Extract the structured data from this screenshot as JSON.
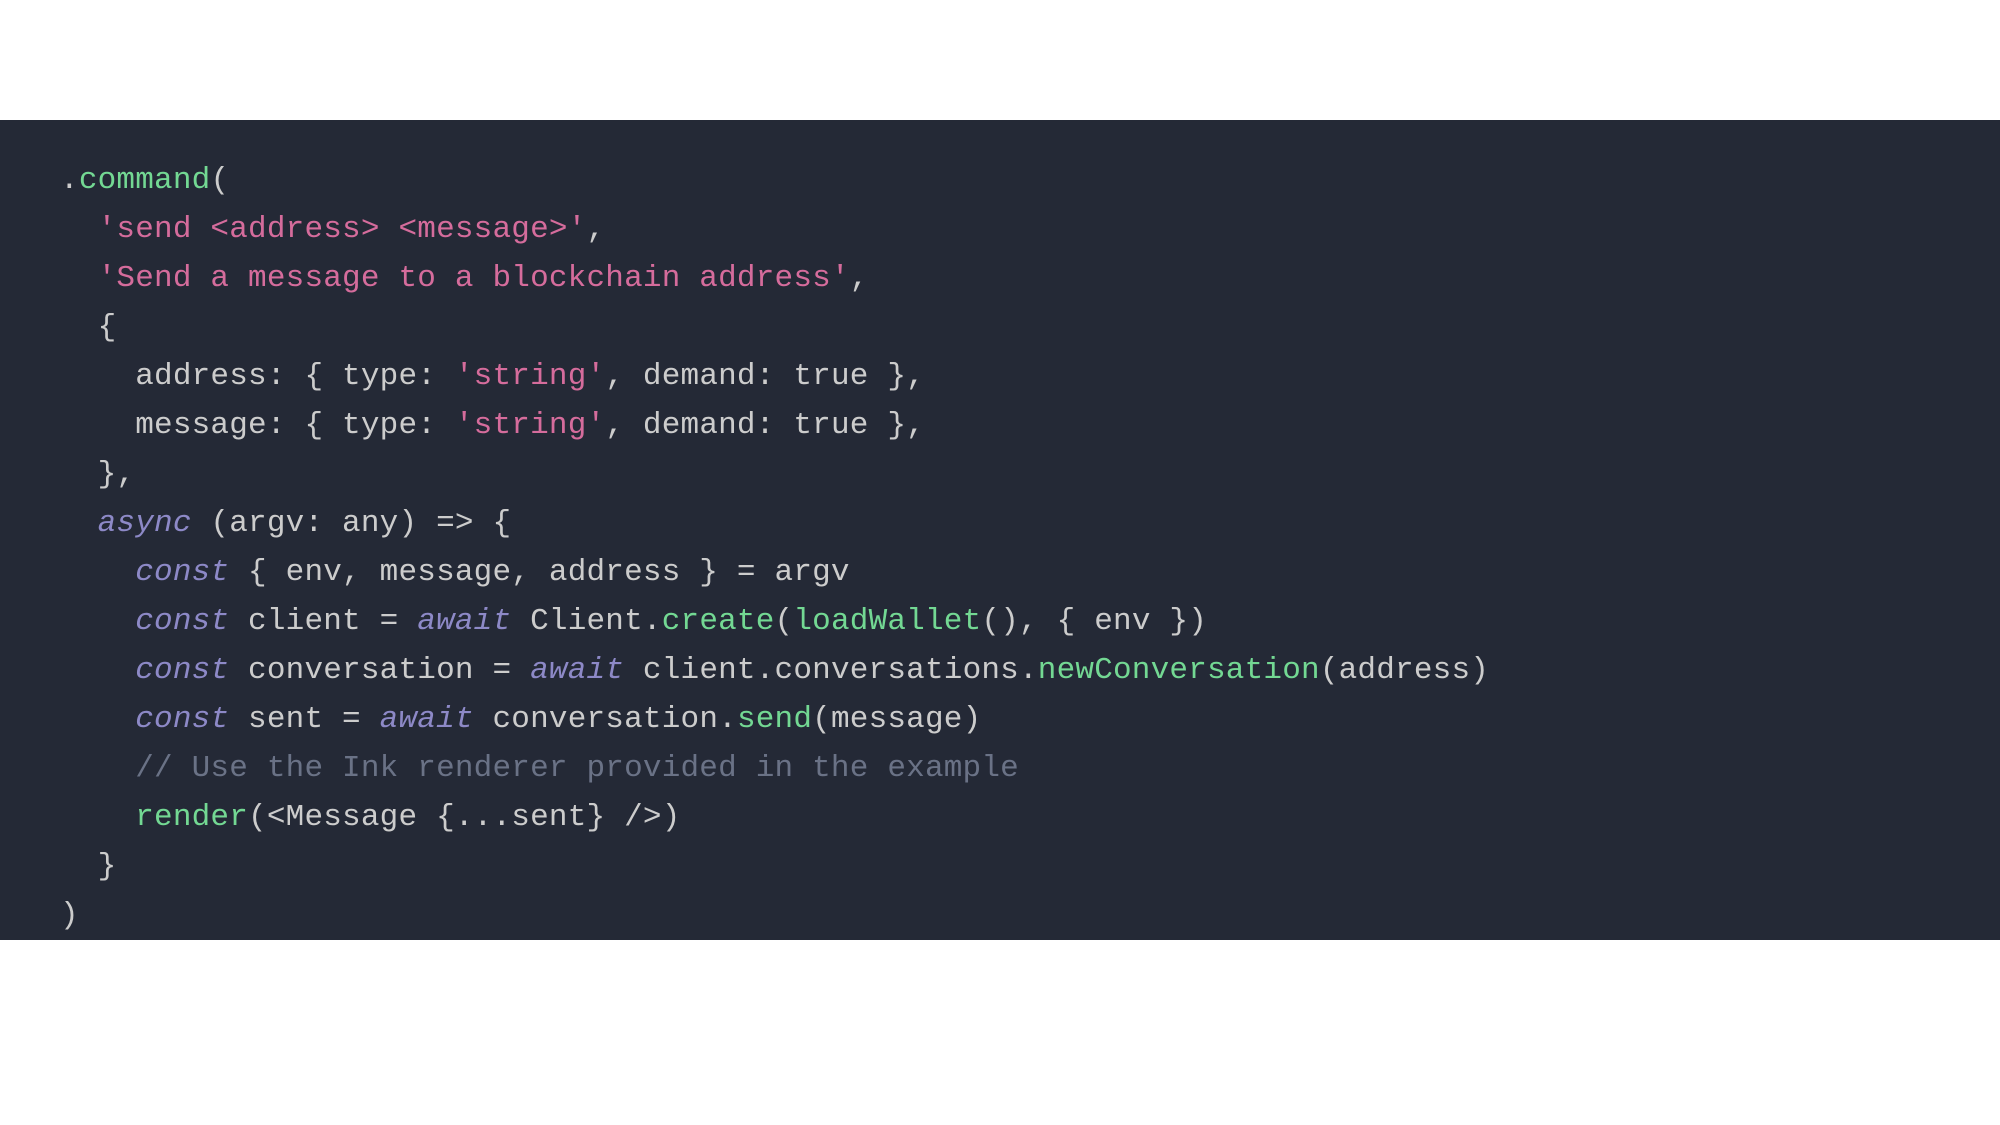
{
  "colors": {
    "background": "#242936",
    "default": "#cccccc",
    "method": "#73d893",
    "string": "#d56c9c",
    "keyword": "#8d89c7",
    "comment": "#6a7286"
  },
  "code": {
    "lines": [
      [
        {
          "cls": "tok-punct",
          "text": "."
        },
        {
          "cls": "tok-method",
          "text": "command"
        },
        {
          "cls": "tok-punct",
          "text": "("
        }
      ],
      [
        {
          "cls": "tok-punct",
          "text": "  "
        },
        {
          "cls": "tok-string",
          "text": "'send <address> <message>'"
        },
        {
          "cls": "tok-punct",
          "text": ","
        }
      ],
      [
        {
          "cls": "tok-punct",
          "text": "  "
        },
        {
          "cls": "tok-string",
          "text": "'Send a message to a blockchain address'"
        },
        {
          "cls": "tok-punct",
          "text": ","
        }
      ],
      [
        {
          "cls": "tok-punct",
          "text": "  {"
        }
      ],
      [
        {
          "cls": "tok-default",
          "text": "    address: { type: "
        },
        {
          "cls": "tok-string",
          "text": "'string'"
        },
        {
          "cls": "tok-default",
          "text": ", demand: true },"
        }
      ],
      [
        {
          "cls": "tok-default",
          "text": "    message: { type: "
        },
        {
          "cls": "tok-string",
          "text": "'string'"
        },
        {
          "cls": "tok-default",
          "text": ", demand: true },"
        }
      ],
      [
        {
          "cls": "tok-punct",
          "text": "  },"
        }
      ],
      [
        {
          "cls": "tok-punct",
          "text": "  "
        },
        {
          "cls": "tok-keyword",
          "text": "async"
        },
        {
          "cls": "tok-default",
          "text": " (argv: any) => {"
        }
      ],
      [
        {
          "cls": "tok-punct",
          "text": "    "
        },
        {
          "cls": "tok-keyword",
          "text": "const"
        },
        {
          "cls": "tok-default",
          "text": " { env, message, address } = argv"
        }
      ],
      [
        {
          "cls": "tok-punct",
          "text": "    "
        },
        {
          "cls": "tok-keyword",
          "text": "const"
        },
        {
          "cls": "tok-default",
          "text": " client = "
        },
        {
          "cls": "tok-keyword",
          "text": "await"
        },
        {
          "cls": "tok-default",
          "text": " Client."
        },
        {
          "cls": "tok-method",
          "text": "create"
        },
        {
          "cls": "tok-default",
          "text": "("
        },
        {
          "cls": "tok-method",
          "text": "loadWallet"
        },
        {
          "cls": "tok-default",
          "text": "(), { env })"
        }
      ],
      [
        {
          "cls": "tok-punct",
          "text": "    "
        },
        {
          "cls": "tok-keyword",
          "text": "const"
        },
        {
          "cls": "tok-default",
          "text": " conversation = "
        },
        {
          "cls": "tok-keyword",
          "text": "await"
        },
        {
          "cls": "tok-default",
          "text": " client.conversations."
        },
        {
          "cls": "tok-method",
          "text": "newConversation"
        },
        {
          "cls": "tok-default",
          "text": "(address)"
        }
      ],
      [
        {
          "cls": "tok-punct",
          "text": "    "
        },
        {
          "cls": "tok-keyword",
          "text": "const"
        },
        {
          "cls": "tok-default",
          "text": " sent = "
        },
        {
          "cls": "tok-keyword",
          "text": "await"
        },
        {
          "cls": "tok-default",
          "text": " conversation."
        },
        {
          "cls": "tok-method",
          "text": "send"
        },
        {
          "cls": "tok-default",
          "text": "(message)"
        }
      ],
      [
        {
          "cls": "tok-punct",
          "text": "    "
        },
        {
          "cls": "tok-comment",
          "text": "// Use the Ink renderer provided in the example"
        }
      ],
      [
        {
          "cls": "tok-default",
          "text": "    "
        },
        {
          "cls": "tok-method",
          "text": "render"
        },
        {
          "cls": "tok-default",
          "text": "(<Message {...sent} />)"
        }
      ],
      [
        {
          "cls": "tok-punct",
          "text": "  }"
        }
      ],
      [
        {
          "cls": "tok-punct",
          "text": ")"
        }
      ]
    ]
  }
}
